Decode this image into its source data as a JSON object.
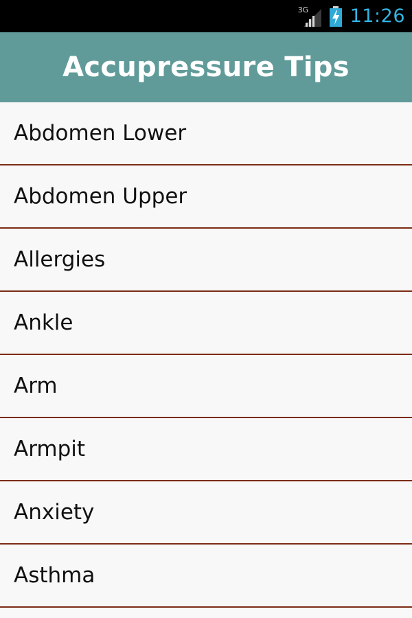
{
  "status_bar": {
    "network_type": "3G",
    "time": "11:26",
    "icons": [
      "signal-icon",
      "battery-charging-icon"
    ],
    "colors": {
      "background": "#000000",
      "clock": "#33b5e5"
    }
  },
  "action_bar": {
    "title": "Accupressure Tips",
    "colors": {
      "background": "#609b99",
      "text": "#ffffff"
    }
  },
  "list": {
    "divider_color": "#7b2b14",
    "items": [
      {
        "label": "Abdomen Lower"
      },
      {
        "label": "Abdomen Upper"
      },
      {
        "label": "Allergies"
      },
      {
        "label": "Ankle"
      },
      {
        "label": "Arm"
      },
      {
        "label": "Armpit"
      },
      {
        "label": "Anxiety"
      },
      {
        "label": "Asthma"
      }
    ]
  }
}
